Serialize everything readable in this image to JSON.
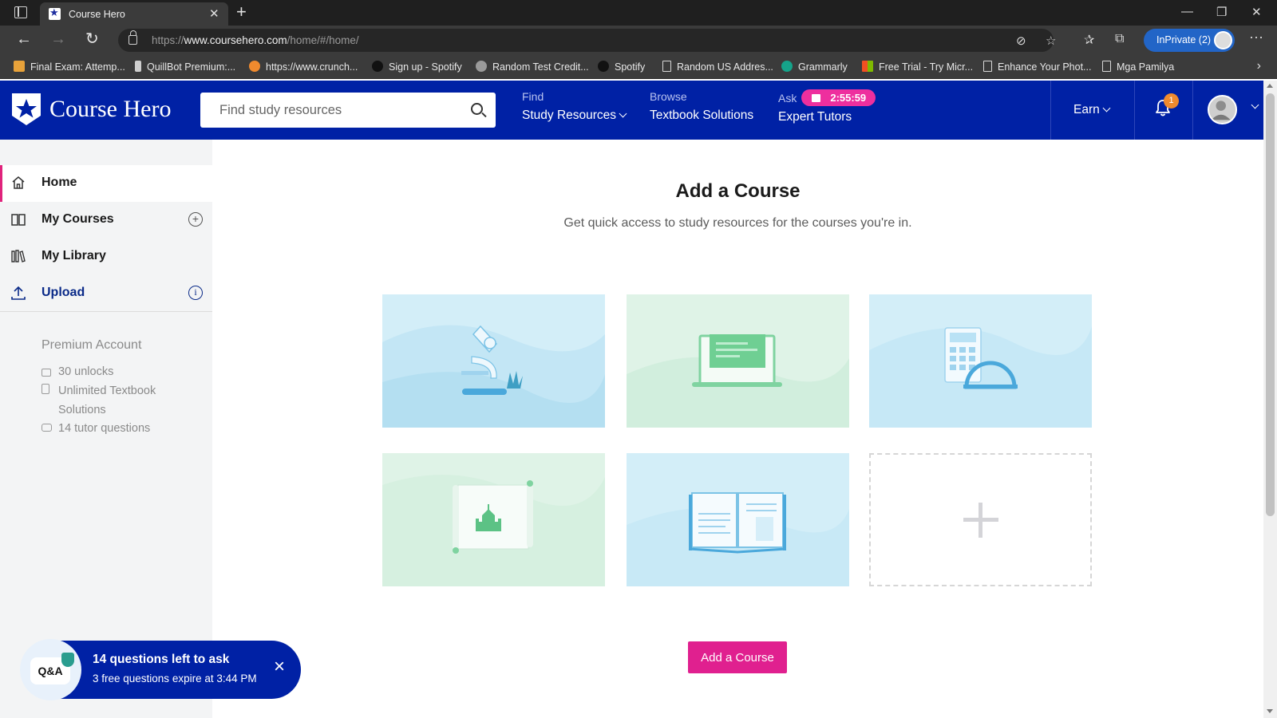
{
  "browser": {
    "tab_title": "Course Hero",
    "url_prefix": "https://",
    "url_domain": "www.coursehero.com",
    "url_path": "/home/#/home/",
    "inprivate_label": "InPrivate (2)",
    "bookmarks": [
      {
        "label": "Final Exam: Attemp..."
      },
      {
        "label": "QuillBot Premium:..."
      },
      {
        "label": "https://www.crunch..."
      },
      {
        "label": "Sign up - Spotify"
      },
      {
        "label": "Random Test Credit..."
      },
      {
        "label": "Spotify"
      },
      {
        "label": "Random US Addres..."
      },
      {
        "label": "Grammarly"
      },
      {
        "label": "Free Trial - Try Micr..."
      },
      {
        "label": "Enhance Your Phot..."
      },
      {
        "label": "Mga Pamilya"
      }
    ]
  },
  "header": {
    "logo_text": "Course Hero",
    "search_placeholder": "Find study resources",
    "nav": [
      {
        "small": "Find",
        "main": "Study Resources"
      },
      {
        "small": "Browse",
        "main": "Textbook Solutions"
      },
      {
        "small": "Ask",
        "main": "Expert Tutors"
      }
    ],
    "timer": "2:55:59",
    "earn_label": "Earn",
    "notification_count": "1"
  },
  "sidebar": {
    "items": [
      {
        "label": "Home",
        "icon": "home-icon"
      },
      {
        "label": "My Courses",
        "icon": "book-icon"
      },
      {
        "label": "My Library",
        "icon": "library-icon"
      },
      {
        "label": "Upload",
        "icon": "upload-icon"
      }
    ],
    "premium": {
      "title": "Premium Account",
      "unlocks": "30 unlocks",
      "textbook_line1": "Unlimited Textbook",
      "textbook_line2": "Solutions",
      "tutor": "14 tutor questions"
    }
  },
  "main": {
    "title": "Add a Course",
    "subtitle": "Get quick access to study resources for the courses you're in.",
    "add_button": "Add a Course"
  },
  "toast": {
    "bubble_label": "Q&A",
    "title": "14 questions left to ask",
    "subtitle": "3 free questions expire at 3:44 PM"
  },
  "colors": {
    "brand_blue": "#0021a5",
    "accent_pink": "#e0208f"
  }
}
